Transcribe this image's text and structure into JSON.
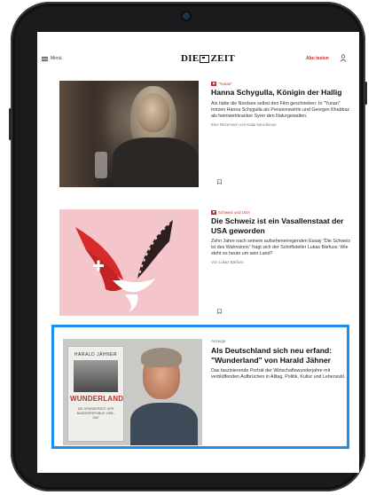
{
  "header": {
    "menu_label": "Menü",
    "logo_left": "DIE",
    "logo_right": "ZEIT",
    "abo_label": "Abo testen"
  },
  "articles": [
    {
      "kicker": "\"Yunan\"",
      "headline": "Hanna Schygulla, Königin der Hallig",
      "teaser": "Als hätte die Nordsee selbst den Film geschrieben: In \"Yunan\" trotzen Hanna Schygulla als Pensionswirtin und Georges Khabbaz als heimwehkranker Syrer den Naturgewalten.",
      "byline": "Eine Rezension von Katja Nicodemus"
    },
    {
      "kicker": "Schweiz und USA",
      "headline": "Die Schweiz ist ein Vasallenstaat der USA geworden",
      "teaser": "Zehn Jahre nach seinem aufsehenerregenden Essay \"Die Schweiz ist des Wahnsinns\" fragt sich der Schriftsteller Lukas Bärfuss: Wie steht es heute um sein Land?",
      "byline": "Von Lukas Bärfuss"
    },
    {
      "label": "Anzeige",
      "headline": "Als Deutschland sich neu erfand: \"Wunderland\" von Harald Jähner",
      "teaser": "Das faszinierende Porträt der Wirtschaftswunderjahre mit verblüffenden Aufbrüchen in Alltag, Politik, Kultur und Lebensstil.",
      "book": {
        "author": "HARALD JÄHNER",
        "title": "WUNDERLAND",
        "subtitle": "DIE GRÜNDERZEIT DER BUNDESREPUBLIK 1955–1967"
      }
    }
  ],
  "colors": {
    "accent": "#c0312b",
    "highlight": "#1f8ef1"
  }
}
